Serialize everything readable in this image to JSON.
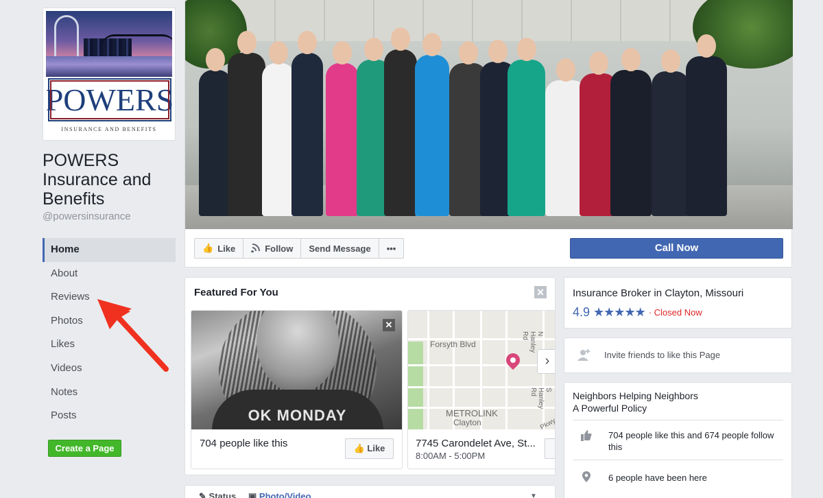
{
  "profile": {
    "logo_text": "POWERS",
    "logo_tagline": "INSURANCE AND BENEFITS",
    "name": "POWERS Insurance and Benefits",
    "handle": "@powersinsurance"
  },
  "nav": {
    "items": [
      {
        "label": "Home",
        "active": true
      },
      {
        "label": "About"
      },
      {
        "label": "Reviews"
      },
      {
        "label": "Photos"
      },
      {
        "label": "Likes"
      },
      {
        "label": "Videos"
      },
      {
        "label": "Notes"
      },
      {
        "label": "Posts"
      }
    ],
    "create_page": "Create a Page"
  },
  "actions": {
    "like": "Like",
    "follow": "Follow",
    "send_message": "Send Message",
    "more": "•••",
    "call_now": "Call Now"
  },
  "featured": {
    "title": "Featured For You",
    "card1": {
      "likes_text": "704 people like this",
      "like_button": "Like",
      "image_text": "OK MONDAY"
    },
    "card2": {
      "address": "7745 Carondelet Ave, St...",
      "hours": "8:00AM - 5:00PM",
      "map_labels": [
        "Forsyth Blvd",
        "METROLINK",
        "Clayton",
        "N Hanley Rd",
        "S Hanley Rd",
        "Pkwy"
      ]
    }
  },
  "composer": {
    "status": "Status",
    "photo_video": "Photo/Video"
  },
  "info": {
    "category": "Insurance Broker in Clayton, Missouri",
    "rating": "4.9",
    "stars": "★★★★★",
    "status": "· Closed Now"
  },
  "invite": {
    "text": "Invite friends to like this Page"
  },
  "about": {
    "line1": "Neighbors Helping Neighbors",
    "line2": "A Powerful Policy",
    "likes_follows": "704 people like this and 674 people follow this",
    "checkins": "6 people have been here"
  },
  "colors": {
    "accent": "#4267b2",
    "create_page_green": "#42b72a",
    "closed_red": "#e02424",
    "arrow_red": "#f0311f",
    "map_pin": "#d8467a"
  },
  "icons": {
    "like": "thumbs-up-icon",
    "follow": "rss-icon",
    "invite": "add-friend-icon",
    "checkin": "location-pin-icon",
    "close": "close-icon",
    "next": "chevron-right-icon"
  }
}
